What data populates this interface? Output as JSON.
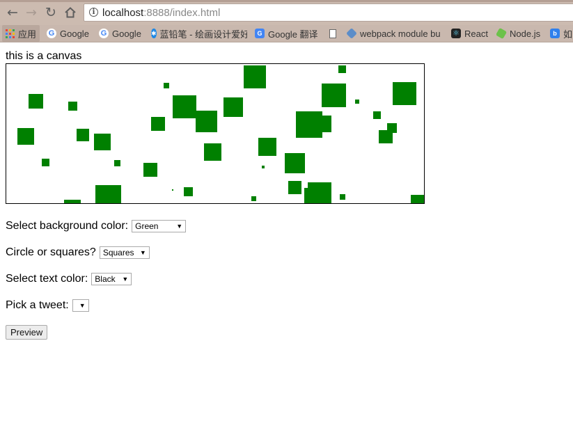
{
  "browser": {
    "url_host": "localhost",
    "url_rest": ":8888/index.html",
    "bookmarks": [
      {
        "label": "应用",
        "icon": "apps-icon"
      },
      {
        "label": "Google",
        "icon": "google-icon"
      },
      {
        "label": "Google",
        "icon": "google-icon"
      },
      {
        "label": "蓝铅笔 - 绘画设计爱好",
        "icon": "lanqianbi-icon"
      },
      {
        "label": "Google 翻译",
        "icon": "google-translate-icon"
      },
      {
        "label": "",
        "icon": "document-icon"
      },
      {
        "label": "webpack module bu",
        "icon": "webpack-icon"
      },
      {
        "label": "React",
        "icon": "react-icon"
      },
      {
        "label": "Node.js",
        "icon": "nodejs-icon"
      },
      {
        "label": "如",
        "icon": "bing-icon"
      }
    ]
  },
  "page": {
    "canvas_title": "this is a canvas",
    "square_color": "#008000",
    "bg_label": "Select background color:",
    "bg_value": "Green",
    "shape_label": "Circle or squares?",
    "shape_value": "Squares",
    "text_label": "Select text color:",
    "text_value": "Black",
    "tweet_label": "Pick a tweet:",
    "tweet_value": "",
    "preview_label": "Preview"
  }
}
